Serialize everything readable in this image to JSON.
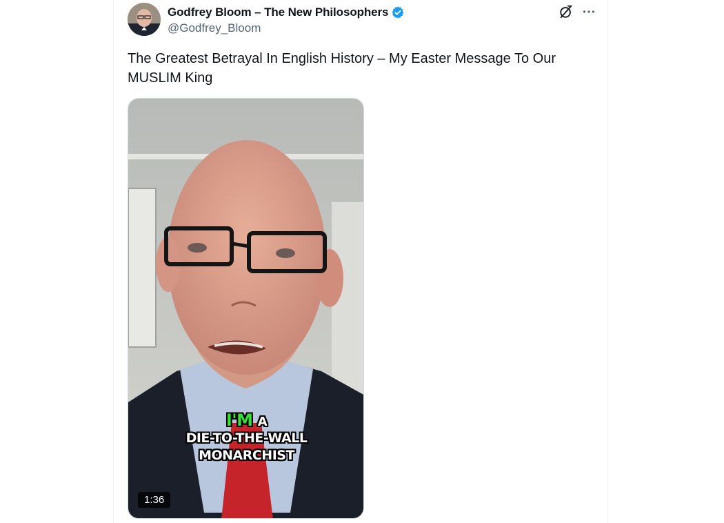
{
  "tweet": {
    "display_name": "Godfrey Bloom – The New Philosophers",
    "handle": "@Godfrey_Bloom",
    "verified_icon": "verified-badge-icon",
    "text": "The Greatest Betrayal In English History – My Easter Message To Our MUSLIM King",
    "actions": {
      "grok_icon": "grok-icon",
      "more_icon": "more-options-icon"
    }
  },
  "video": {
    "duration": "1:36",
    "caption": {
      "word1": "I'M",
      "word2": "A",
      "line2": "DIE-TO-THE-WALL",
      "line3": "MONARCHIST"
    }
  },
  "colors": {
    "verified_blue": "#1d9bf0",
    "handle_gray": "#536471",
    "caption_highlight": "#35e03a"
  }
}
